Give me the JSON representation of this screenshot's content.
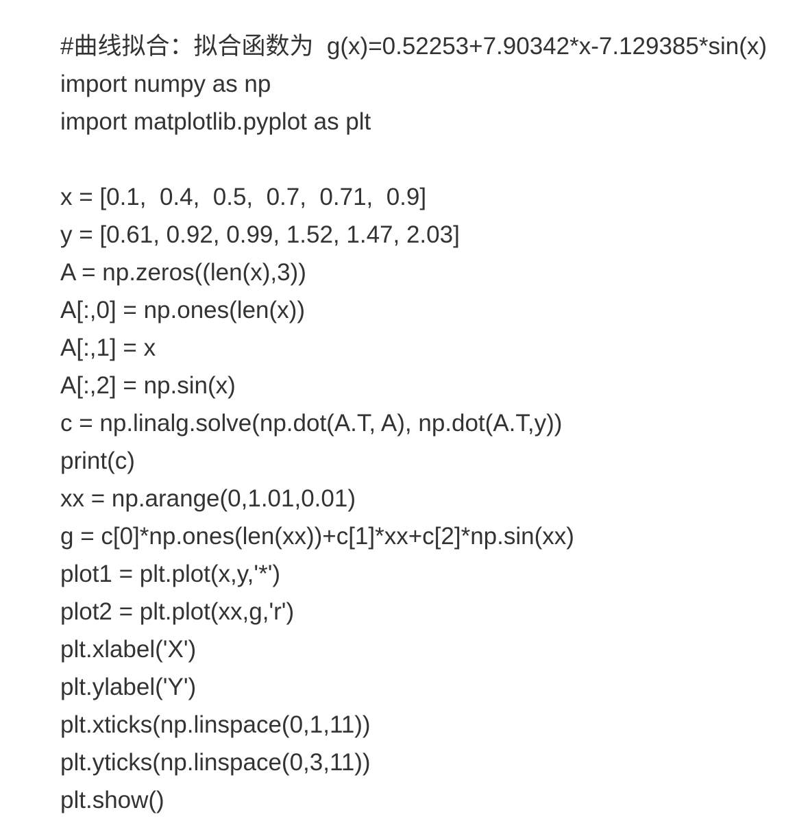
{
  "code": {
    "lines": [
      "#曲线拟合：拟合函数为  g(x)=0.52253+7.90342*x-7.129385*sin(x)",
      "import numpy as np",
      "import matplotlib.pyplot as plt",
      "",
      "x = [0.1,  0.4,  0.5,  0.7,  0.71,  0.9]",
      "y = [0.61, 0.92, 0.99, 1.52, 1.47, 2.03]",
      "A = np.zeros((len(x),3))",
      "A[:,0] = np.ones(len(x))",
      "A[:,1] = x",
      "A[:,2] = np.sin(x)",
      "c = np.linalg.solve(np.dot(A.T, A), np.dot(A.T,y))",
      "print(c)",
      "xx = np.arange(0,1.01,0.01)",
      "g = c[0]*np.ones(len(xx))+c[1]*xx+c[2]*np.sin(xx)",
      "plot1 = plt.plot(x,y,'*')",
      "plot2 = plt.plot(xx,g,'r')",
      "plt.xlabel('X')",
      "plt.ylabel('Y')",
      "plt.xticks(np.linspace(0,1,11))",
      "plt.yticks(np.linspace(0,3,11))",
      "plt.show()"
    ]
  }
}
